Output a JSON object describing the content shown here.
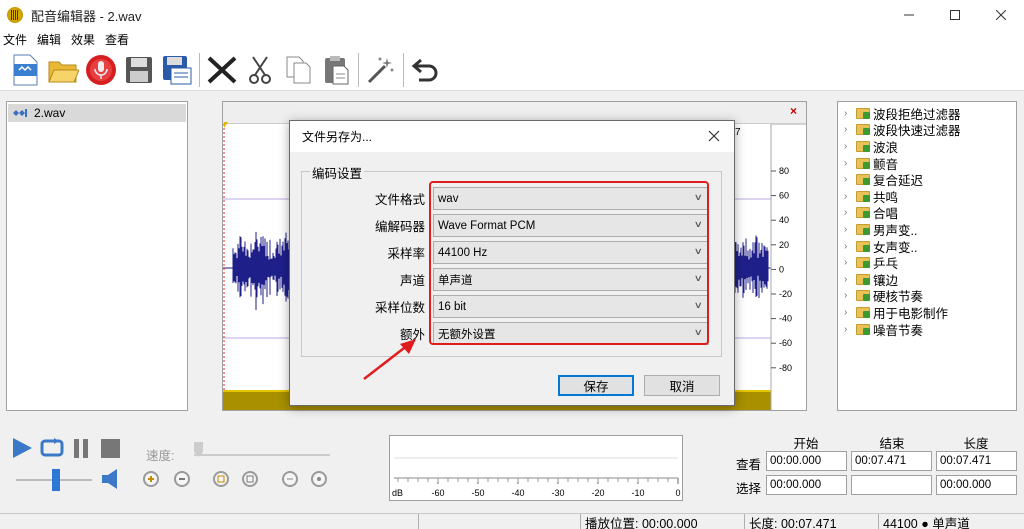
{
  "window": {
    "title": "配音编辑器 - 2.wav"
  },
  "menu": [
    "文件",
    "编辑",
    "效果",
    "查看"
  ],
  "toolbar": {
    "icons": [
      "new-file-icon",
      "open-folder-icon",
      "record-icon",
      "save-icon",
      "save-as-icon",
      "delete-icon",
      "cut-icon",
      "copy-icon",
      "paste-icon",
      "magic-wand-icon",
      "undo-icon"
    ]
  },
  "file_list": {
    "items": [
      "2.wav"
    ]
  },
  "waveform": {
    "y_ticks": [
      "80",
      "60",
      "40",
      "20",
      "0",
      "-20",
      "-40",
      "-60",
      "-80"
    ],
    "close_glyph": "×",
    "timeline_fragment": "7"
  },
  "effects": {
    "items": [
      "波段拒绝过滤器",
      "波段快速过滤器",
      "波浪",
      "颤音",
      "复合延迟",
      "共鸣",
      "合唱",
      "男声变..",
      "女声变..",
      "乒乓",
      "镶边",
      "硬核节奏",
      "用于电影制作",
      "噪音节奏"
    ]
  },
  "dialog": {
    "title": "文件另存为...",
    "group_label": "编码设置",
    "fields": [
      {
        "label": "文件格式",
        "value": "wav"
      },
      {
        "label": "编解码器",
        "value": "Wave Format PCM"
      },
      {
        "label": "采样率",
        "value": "44100 Hz"
      },
      {
        "label": "声道",
        "value": "单声道"
      },
      {
        "label": "采样位数",
        "value": "16 bit"
      },
      {
        "label": "额外",
        "value": "无额外设置"
      }
    ],
    "save_label": "保存",
    "cancel_label": "取消",
    "annotation_color": "#e01d1d"
  },
  "playback": {
    "speed_label": "速度:",
    "volume_level": 0.5
  },
  "meter": {
    "unit": "dB",
    "ticks": [
      "-60",
      "-50",
      "-40",
      "-30",
      "-20",
      "-10",
      "0"
    ]
  },
  "selection": {
    "headers": [
      "开始",
      "结束",
      "长度"
    ],
    "rows": [
      {
        "label": "查看",
        "start": "00:00.000",
        "end": "00:07.471",
        "length": "00:07.471"
      },
      {
        "label": "选择",
        "start": "00:00.000",
        "end": "",
        "length": "00:00.000"
      }
    ]
  },
  "status": {
    "play_position": "播放位置: 00:00.000",
    "length": "长度: 00:07.471",
    "format": "44100 ● 单声道"
  }
}
